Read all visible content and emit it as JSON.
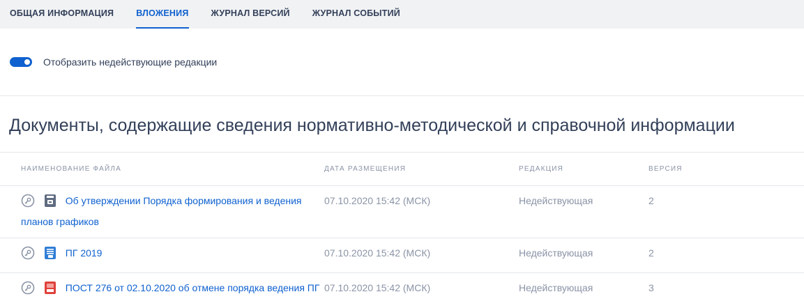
{
  "tabs": [
    {
      "label": "ОБЩАЯ ИНФОРМАЦИЯ",
      "active": false
    },
    {
      "label": "ВЛОЖЕНИЯ",
      "active": true
    },
    {
      "label": "ЖУРНАЛ ВЕРСИЙ",
      "active": false
    },
    {
      "label": "ЖУРНАЛ СОБЫТИЙ",
      "active": false
    }
  ],
  "toggle": {
    "label": "Отобразить недействующие редакции",
    "on": true
  },
  "section": {
    "title": "Документы, содержащие сведения нормативно-методической и справочной информации"
  },
  "table": {
    "headers": [
      "НАИМЕНОВАНИЕ ФАЙЛА",
      "ДАТА РАЗМЕЩЕНИЯ",
      "РЕДАКЦИЯ",
      "ВЕРСИЯ"
    ],
    "rows": [
      {
        "name": "Об утверждении Порядка формирования и ведения планов графиков",
        "date": "07.10.2020 15:42 (МСК)",
        "edition": "Недействующая",
        "version": "2",
        "file_icon": "archive-file-icon"
      },
      {
        "name": "ПГ 2019",
        "date": "07.10.2020 15:42 (МСК)",
        "edition": "Недействующая",
        "version": "2",
        "file_icon": "doc-file-icon"
      },
      {
        "name": "ПОСТ 276 от 02.10.2020 об отмене порядка ведения ПГ",
        "date": "07.10.2020 15:42 (МСК)",
        "edition": "Недействующая",
        "version": "3",
        "file_icon": "pdf-file-icon"
      }
    ]
  },
  "colors": {
    "accent": "#0f61cf",
    "text": "#334059",
    "muted": "#8a93a6",
    "tabs_bg": "#f1f2f4"
  }
}
